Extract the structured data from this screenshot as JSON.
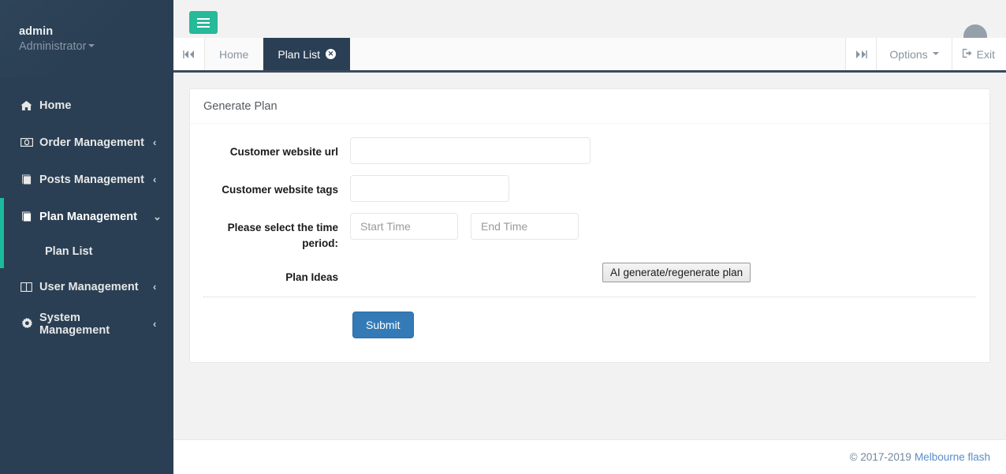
{
  "sidebar": {
    "profile": {
      "name": "admin",
      "role": "Administrator"
    },
    "items": [
      {
        "label": "Home",
        "icon": "home-icon",
        "arrow": ""
      },
      {
        "label": "Order Management",
        "icon": "money-icon",
        "arrow": "‹"
      },
      {
        "label": "Posts Management",
        "icon": "book-icon",
        "arrow": "‹"
      },
      {
        "label": "Plan Management",
        "icon": "book-icon",
        "arrow": "⌄"
      },
      {
        "label": "User Management",
        "icon": "columns-icon",
        "arrow": "‹"
      },
      {
        "label": "System Management",
        "icon": "gear-icon",
        "arrow": "‹"
      }
    ],
    "submenu": [
      {
        "label": "Plan List"
      }
    ],
    "accent_color": "#1ABB9C",
    "background_color": "#2A3F54"
  },
  "topbar": {
    "menu_toggle_icon": "hamburger-icon",
    "menu_toggle_color": "#26B99A"
  },
  "tabbar": {
    "scroll_left_icon": "double-chevron-left-icon",
    "scroll_right_icon": "double-chevron-right-icon",
    "tabs": [
      {
        "label": "Home",
        "active": false,
        "closable": false
      },
      {
        "label": "Plan List",
        "active": true,
        "closable": true,
        "close_icon": "close-circle-icon"
      }
    ],
    "options_label": "Options",
    "exit_label": "Exit",
    "exit_icon": "sign-out-icon"
  },
  "panel": {
    "title": "Generate Plan",
    "fields": [
      {
        "label": "Customer website url",
        "value": "",
        "placeholder": ""
      },
      {
        "label": "Customer website tags",
        "value": "",
        "placeholder": ""
      },
      {
        "label": "Please select the time period:",
        "start_value": "",
        "start_placeholder": "Start Time",
        "end_value": "",
        "end_placeholder": "End Time"
      },
      {
        "label": "Plan Ideas"
      }
    ],
    "ai_button_label": "AI generate/regenerate plan",
    "submit_label": "Submit",
    "submit_color": "#337AB7"
  },
  "footer": {
    "copyright": "© 2017-2019",
    "link_label": "Melbourne flash",
    "link_color": "#5A8DC8"
  }
}
